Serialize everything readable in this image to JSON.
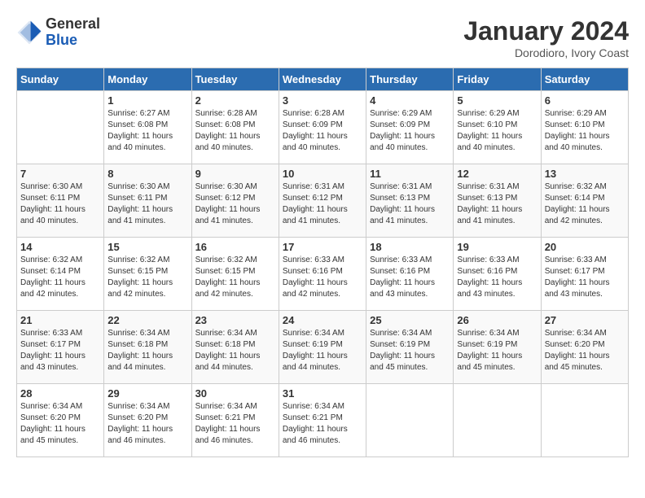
{
  "header": {
    "logo_general": "General",
    "logo_blue": "Blue",
    "month_title": "January 2024",
    "location": "Dorodioro, Ivory Coast"
  },
  "days_of_week": [
    "Sunday",
    "Monday",
    "Tuesday",
    "Wednesday",
    "Thursday",
    "Friday",
    "Saturday"
  ],
  "weeks": [
    [
      {
        "day": "",
        "sunrise": "",
        "sunset": "",
        "daylight": ""
      },
      {
        "day": "1",
        "sunrise": "Sunrise: 6:27 AM",
        "sunset": "Sunset: 6:08 PM",
        "daylight": "Daylight: 11 hours and 40 minutes."
      },
      {
        "day": "2",
        "sunrise": "Sunrise: 6:28 AM",
        "sunset": "Sunset: 6:08 PM",
        "daylight": "Daylight: 11 hours and 40 minutes."
      },
      {
        "day": "3",
        "sunrise": "Sunrise: 6:28 AM",
        "sunset": "Sunset: 6:09 PM",
        "daylight": "Daylight: 11 hours and 40 minutes."
      },
      {
        "day": "4",
        "sunrise": "Sunrise: 6:29 AM",
        "sunset": "Sunset: 6:09 PM",
        "daylight": "Daylight: 11 hours and 40 minutes."
      },
      {
        "day": "5",
        "sunrise": "Sunrise: 6:29 AM",
        "sunset": "Sunset: 6:10 PM",
        "daylight": "Daylight: 11 hours and 40 minutes."
      },
      {
        "day": "6",
        "sunrise": "Sunrise: 6:29 AM",
        "sunset": "Sunset: 6:10 PM",
        "daylight": "Daylight: 11 hours and 40 minutes."
      }
    ],
    [
      {
        "day": "7",
        "sunrise": "Sunrise: 6:30 AM",
        "sunset": "Sunset: 6:11 PM",
        "daylight": "Daylight: 11 hours and 40 minutes."
      },
      {
        "day": "8",
        "sunrise": "Sunrise: 6:30 AM",
        "sunset": "Sunset: 6:11 PM",
        "daylight": "Daylight: 11 hours and 41 minutes."
      },
      {
        "day": "9",
        "sunrise": "Sunrise: 6:30 AM",
        "sunset": "Sunset: 6:12 PM",
        "daylight": "Daylight: 11 hours and 41 minutes."
      },
      {
        "day": "10",
        "sunrise": "Sunrise: 6:31 AM",
        "sunset": "Sunset: 6:12 PM",
        "daylight": "Daylight: 11 hours and 41 minutes."
      },
      {
        "day": "11",
        "sunrise": "Sunrise: 6:31 AM",
        "sunset": "Sunset: 6:13 PM",
        "daylight": "Daylight: 11 hours and 41 minutes."
      },
      {
        "day": "12",
        "sunrise": "Sunrise: 6:31 AM",
        "sunset": "Sunset: 6:13 PM",
        "daylight": "Daylight: 11 hours and 41 minutes."
      },
      {
        "day": "13",
        "sunrise": "Sunrise: 6:32 AM",
        "sunset": "Sunset: 6:14 PM",
        "daylight": "Daylight: 11 hours and 42 minutes."
      }
    ],
    [
      {
        "day": "14",
        "sunrise": "Sunrise: 6:32 AM",
        "sunset": "Sunset: 6:14 PM",
        "daylight": "Daylight: 11 hours and 42 minutes."
      },
      {
        "day": "15",
        "sunrise": "Sunrise: 6:32 AM",
        "sunset": "Sunset: 6:15 PM",
        "daylight": "Daylight: 11 hours and 42 minutes."
      },
      {
        "day": "16",
        "sunrise": "Sunrise: 6:32 AM",
        "sunset": "Sunset: 6:15 PM",
        "daylight": "Daylight: 11 hours and 42 minutes."
      },
      {
        "day": "17",
        "sunrise": "Sunrise: 6:33 AM",
        "sunset": "Sunset: 6:16 PM",
        "daylight": "Daylight: 11 hours and 42 minutes."
      },
      {
        "day": "18",
        "sunrise": "Sunrise: 6:33 AM",
        "sunset": "Sunset: 6:16 PM",
        "daylight": "Daylight: 11 hours and 43 minutes."
      },
      {
        "day": "19",
        "sunrise": "Sunrise: 6:33 AM",
        "sunset": "Sunset: 6:16 PM",
        "daylight": "Daylight: 11 hours and 43 minutes."
      },
      {
        "day": "20",
        "sunrise": "Sunrise: 6:33 AM",
        "sunset": "Sunset: 6:17 PM",
        "daylight": "Daylight: 11 hours and 43 minutes."
      }
    ],
    [
      {
        "day": "21",
        "sunrise": "Sunrise: 6:33 AM",
        "sunset": "Sunset: 6:17 PM",
        "daylight": "Daylight: 11 hours and 43 minutes."
      },
      {
        "day": "22",
        "sunrise": "Sunrise: 6:34 AM",
        "sunset": "Sunset: 6:18 PM",
        "daylight": "Daylight: 11 hours and 44 minutes."
      },
      {
        "day": "23",
        "sunrise": "Sunrise: 6:34 AM",
        "sunset": "Sunset: 6:18 PM",
        "daylight": "Daylight: 11 hours and 44 minutes."
      },
      {
        "day": "24",
        "sunrise": "Sunrise: 6:34 AM",
        "sunset": "Sunset: 6:19 PM",
        "daylight": "Daylight: 11 hours and 44 minutes."
      },
      {
        "day": "25",
        "sunrise": "Sunrise: 6:34 AM",
        "sunset": "Sunset: 6:19 PM",
        "daylight": "Daylight: 11 hours and 45 minutes."
      },
      {
        "day": "26",
        "sunrise": "Sunrise: 6:34 AM",
        "sunset": "Sunset: 6:19 PM",
        "daylight": "Daylight: 11 hours and 45 minutes."
      },
      {
        "day": "27",
        "sunrise": "Sunrise: 6:34 AM",
        "sunset": "Sunset: 6:20 PM",
        "daylight": "Daylight: 11 hours and 45 minutes."
      }
    ],
    [
      {
        "day": "28",
        "sunrise": "Sunrise: 6:34 AM",
        "sunset": "Sunset: 6:20 PM",
        "daylight": "Daylight: 11 hours and 45 minutes."
      },
      {
        "day": "29",
        "sunrise": "Sunrise: 6:34 AM",
        "sunset": "Sunset: 6:20 PM",
        "daylight": "Daylight: 11 hours and 46 minutes."
      },
      {
        "day": "30",
        "sunrise": "Sunrise: 6:34 AM",
        "sunset": "Sunset: 6:21 PM",
        "daylight": "Daylight: 11 hours and 46 minutes."
      },
      {
        "day": "31",
        "sunrise": "Sunrise: 6:34 AM",
        "sunset": "Sunset: 6:21 PM",
        "daylight": "Daylight: 11 hours and 46 minutes."
      },
      {
        "day": "",
        "sunrise": "",
        "sunset": "",
        "daylight": ""
      },
      {
        "day": "",
        "sunrise": "",
        "sunset": "",
        "daylight": ""
      },
      {
        "day": "",
        "sunrise": "",
        "sunset": "",
        "daylight": ""
      }
    ]
  ]
}
